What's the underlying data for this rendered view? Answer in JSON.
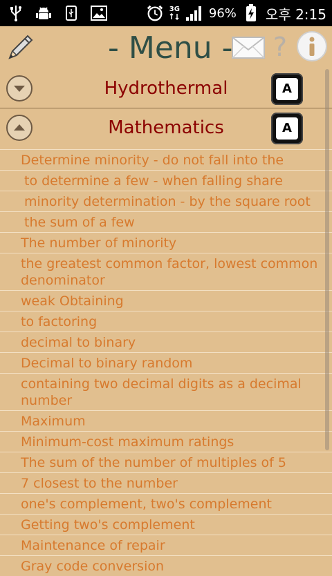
{
  "status_bar": {
    "battery": "96%",
    "network": "3G",
    "time": "오후 2:15"
  },
  "header": {
    "title": "- Menu -",
    "help_symbol": "?",
    "info_symbol": "i"
  },
  "categories": [
    {
      "label": "Hydrothermal",
      "state": "collapsed",
      "font_button": "A"
    },
    {
      "label": "Mathematics",
      "state": "expanded",
      "font_button": "A"
    }
  ],
  "items": [
    "Determine minority - do not fall into the",
    " to determine a few - when falling share",
    " minority determination - by the square root",
    " the sum of a few",
    "The number of minority",
    "the greatest common factor, lowest common denominator",
    "weak Obtaining",
    "to factoring",
    "decimal to binary",
    "Decimal to binary random",
    "containing two decimal digits as a decimal number",
    "Maximum",
    "Minimum-cost maximum ratings",
    "The sum of the number of multiples of 5",
    "7 closest to the number",
    "one's complement, two's complement",
    "Getting two's complement",
    "Maintenance of repair",
    "Gray code conversion"
  ],
  "colors": {
    "background": "#e1bf8f",
    "title": "#2f4f46",
    "category": "#8b0000",
    "item": "#d77a2e"
  }
}
